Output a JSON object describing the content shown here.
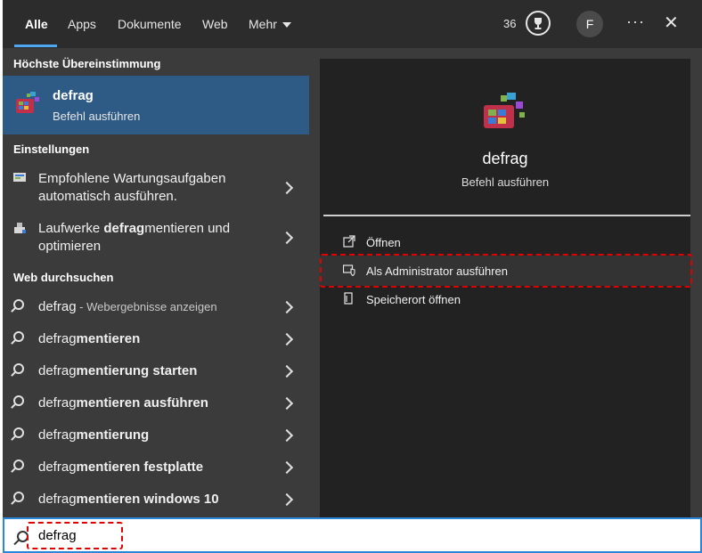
{
  "tabs": [
    "Alle",
    "Apps",
    "Dokumente",
    "Web",
    "Mehr"
  ],
  "header": {
    "points": "36",
    "avatar_letter": "F",
    "more_label": "···",
    "close_label": "✕"
  },
  "left": {
    "best_match_heading": "Höchste Übereinstimmung",
    "best_match": {
      "title": "defrag",
      "subtitle": "Befehl ausführen"
    },
    "settings_heading": "Einstellungen",
    "settings": [
      {
        "line1": "Empfohlene Wartungsaufgaben",
        "line2": "automatisch ausführen."
      },
      {
        "line1_pre": "Laufwerke ",
        "line1_bold": "defrag",
        "line1_post": "mentieren und",
        "line2": "optimieren"
      }
    ],
    "web_heading": "Web durchsuchen",
    "web": [
      {
        "pre": "defrag",
        "bold": "",
        "hint": " - Webergebnisse anzeigen"
      },
      {
        "pre": "defrag",
        "bold": "mentieren",
        "hint": ""
      },
      {
        "pre": "defrag",
        "bold": "mentierung starten",
        "hint": ""
      },
      {
        "pre": "defrag",
        "bold": "mentieren ausführen",
        "hint": ""
      },
      {
        "pre": "defrag",
        "bold": "mentierung",
        "hint": ""
      },
      {
        "pre": "defrag",
        "bold": "mentieren festplatte",
        "hint": ""
      },
      {
        "pre": "defrag",
        "bold": "mentieren windows 10",
        "hint": ""
      }
    ]
  },
  "right": {
    "title": "defrag",
    "subtitle": "Befehl ausführen",
    "actions": [
      {
        "label": "Öffnen",
        "icon": "open-icon"
      },
      {
        "label": "Als Administrator ausführen",
        "icon": "shield-admin-icon"
      },
      {
        "label": "Speicherort öffnen",
        "icon": "file-location-icon"
      }
    ]
  },
  "search": {
    "value": "defrag"
  },
  "colors": {
    "highlight": "#2e5a86",
    "accent": "#4ea7f0",
    "annotation": "#e00000"
  }
}
